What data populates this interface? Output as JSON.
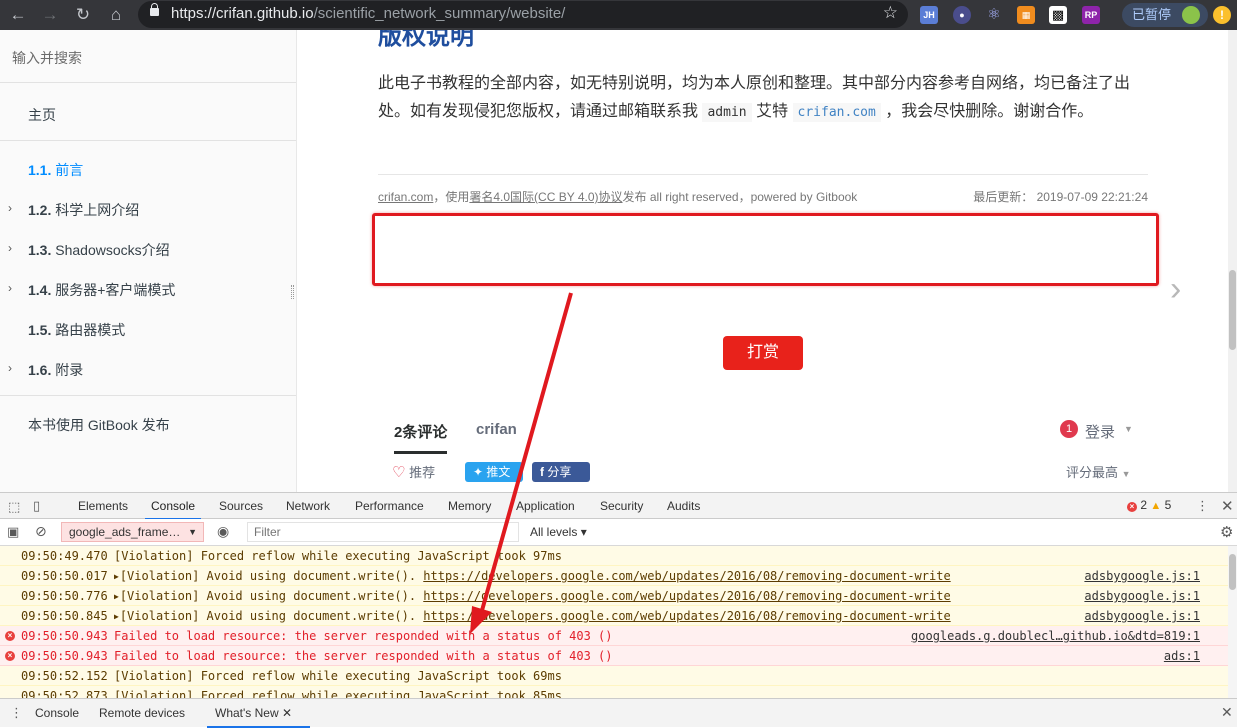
{
  "browser": {
    "url_host": "https://crifan.github.io",
    "url_path": "/scientific_network_summary/website/",
    "ext1": "JH",
    "ext2": "RP",
    "paused_label": "已暂停",
    "warn_glyph": "!"
  },
  "sidebar": {
    "search_placeholder": "输入并搜索",
    "home": "主页",
    "items": [
      {
        "num": "1.1.",
        "label": "前言"
      },
      {
        "num": "1.2.",
        "label": "科学上网介绍"
      },
      {
        "num": "1.3.",
        "label": "Shadowsocks介绍"
      },
      {
        "num": "1.4.",
        "label": "服务器+客户端模式"
      },
      {
        "num": "1.5.",
        "label": "路由器模式"
      },
      {
        "num": "1.6.",
        "label": "附录"
      }
    ],
    "published": "本书使用 GitBook 发布"
  },
  "content": {
    "heading_partial": "版权说明",
    "para_part1": "此电子书教程的全部内容，如无特别说明，均为本人原创和整理。其中部分内容参考自网络，均已备注了出处。如有发现侵犯您版权，请通过邮箱联系我",
    "code_admin": "admin",
    "at_text": "艾特",
    "code_domain": "crifan.com",
    "para_part2": "，我会尽快删除。谢谢合作。",
    "footer_site": "crifan.com",
    "footer_use": "，使用",
    "footer_license": "署名4.0国际(CC BY 4.0)协议",
    "footer_rest": "发布 all right reserved，powered by Gitbook",
    "footer_updated_label": "最后更新：",
    "footer_updated": "2019-07-09 22:21:24",
    "reward": "打赏",
    "comments_tab": "2条评论",
    "site_tab": "crifan",
    "badge": "1",
    "login": "登录",
    "recommend": "推荐",
    "tweet": "推文",
    "share": "分享",
    "sort": "评分最高"
  },
  "devtools": {
    "tabs": [
      "Elements",
      "Console",
      "Sources",
      "Network",
      "Performance",
      "Memory",
      "Application",
      "Security",
      "Audits"
    ],
    "active_tab": "Console",
    "error_count": "2",
    "warning_count": "5",
    "context": "google_ads_frame…",
    "filter_placeholder": "Filter",
    "levels": "All levels",
    "rows": [
      {
        "type": "warn",
        "ts": "09:50:49.470",
        "expand": false,
        "msg": "[Violation] Forced reflow while executing JavaScript took 97ms",
        "link": "",
        "src": ""
      },
      {
        "type": "warn",
        "ts": "09:50:50.017",
        "expand": true,
        "msg": "[Violation] Avoid using document.write(). ",
        "link": "https://developers.google.com/web/updates/2016/08/removing-document-write",
        "src": "adsbygoogle.js:1"
      },
      {
        "type": "warn",
        "ts": "09:50:50.776",
        "expand": true,
        "msg": "[Violation] Avoid using document.write(). ",
        "link": "https://developers.google.com/web/updates/2016/08/removing-document-write",
        "src": "adsbygoogle.js:1"
      },
      {
        "type": "warn",
        "ts": "09:50:50.845",
        "expand": true,
        "msg": "[Violation] Avoid using document.write(). ",
        "link": "https://developers.google.com/web/updates/2016/08/removing-document-write",
        "src": "adsbygoogle.js:1"
      },
      {
        "type": "error",
        "ts": "09:50:50.943",
        "expand": false,
        "msg": "Failed to load resource: the server responded with a status of 403 ()",
        "link": "",
        "src": "googleads.g.doublecl…github.io&dtd=819:1"
      },
      {
        "type": "error",
        "ts": "09:50:50.943",
        "expand": false,
        "msg": "Failed to load resource: the server responded with a status of 403 ()",
        "link": "",
        "src": "ads:1"
      },
      {
        "type": "warn",
        "ts": "09:50:52.152",
        "expand": false,
        "msg": "[Violation] Forced reflow while executing JavaScript took 69ms",
        "link": "",
        "src": ""
      },
      {
        "type": "warn",
        "ts": "09:50:52.873",
        "expand": false,
        "msg": "[Violation] Forced reflow while executing JavaScript took 85ms",
        "link": "",
        "src": ""
      }
    ],
    "drawer_tabs": [
      "Console",
      "Remote devices",
      "What's New"
    ],
    "drawer_active": "What's New"
  },
  "colors": {
    "annotation_red": "#e0191f",
    "link_blue": "#008cff",
    "error_red": "#e2202a"
  }
}
